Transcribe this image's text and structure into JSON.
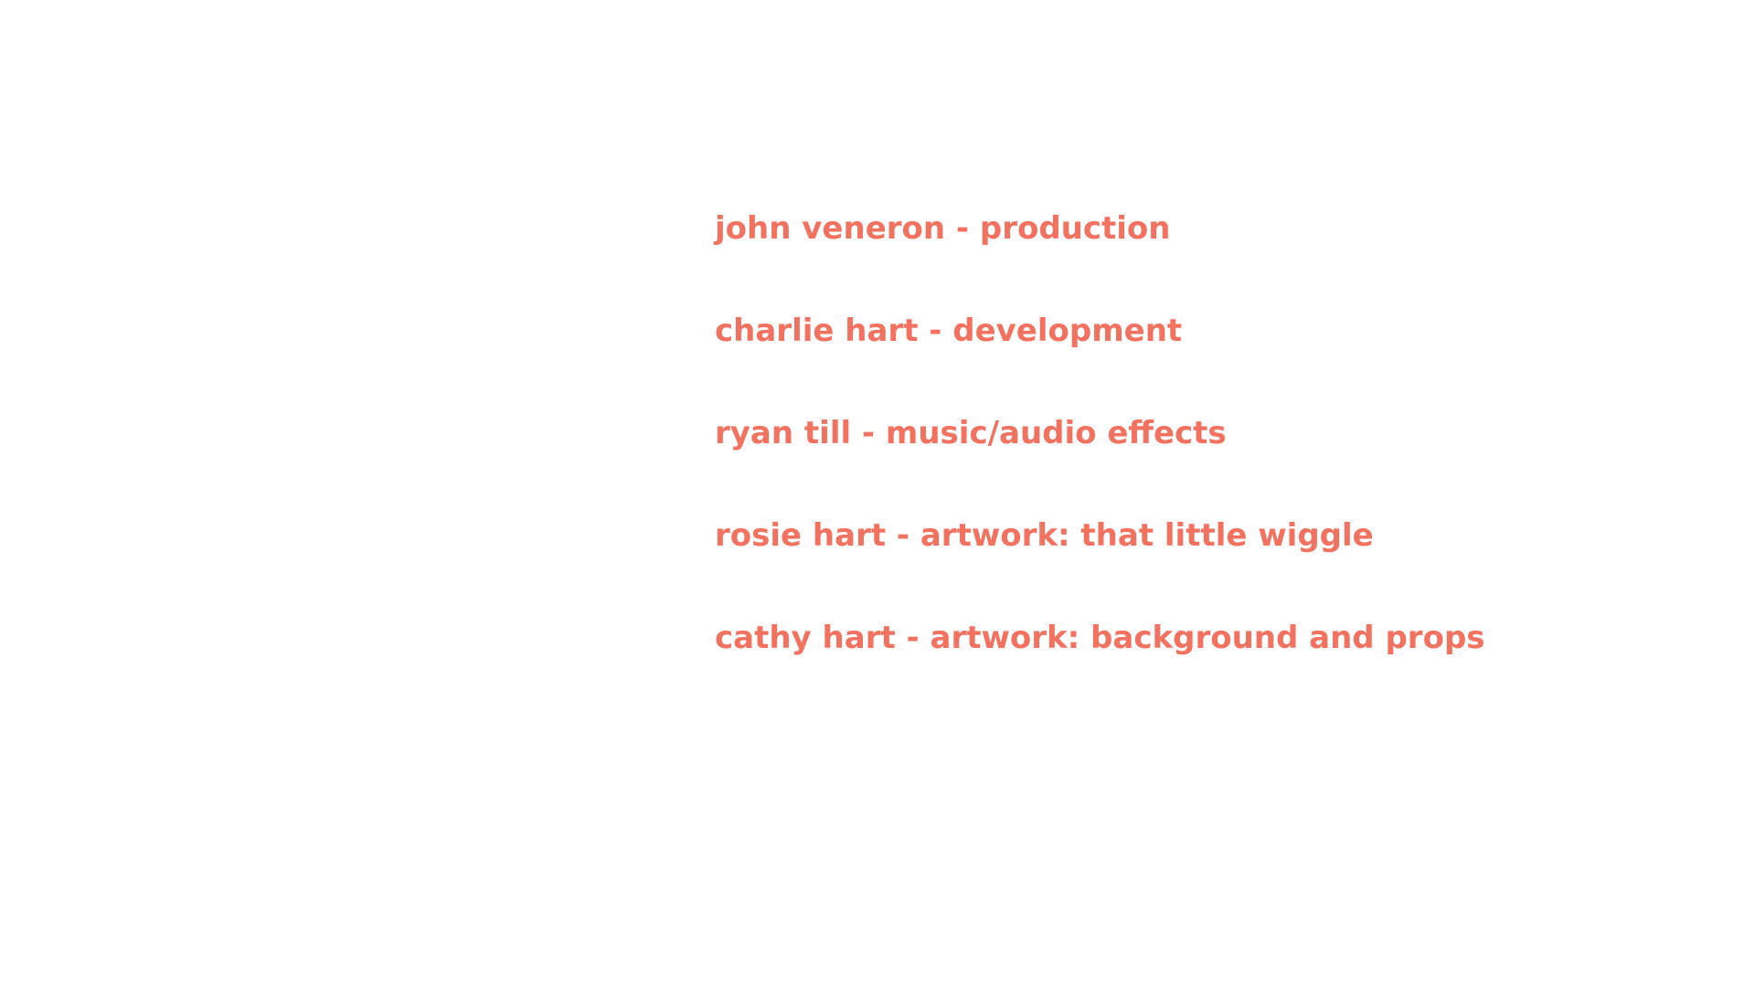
{
  "theme": {
    "background_color": "#ffffff",
    "text_color": "#f2715f"
  },
  "credits": [
    {
      "text": "john veneron - production"
    },
    {
      "text": "charlie hart - development"
    },
    {
      "text": "ryan till - music/audio effects"
    },
    {
      "text": "rosie hart - artwork: that little wiggle"
    },
    {
      "text": "cathy hart - artwork: background and props"
    }
  ]
}
